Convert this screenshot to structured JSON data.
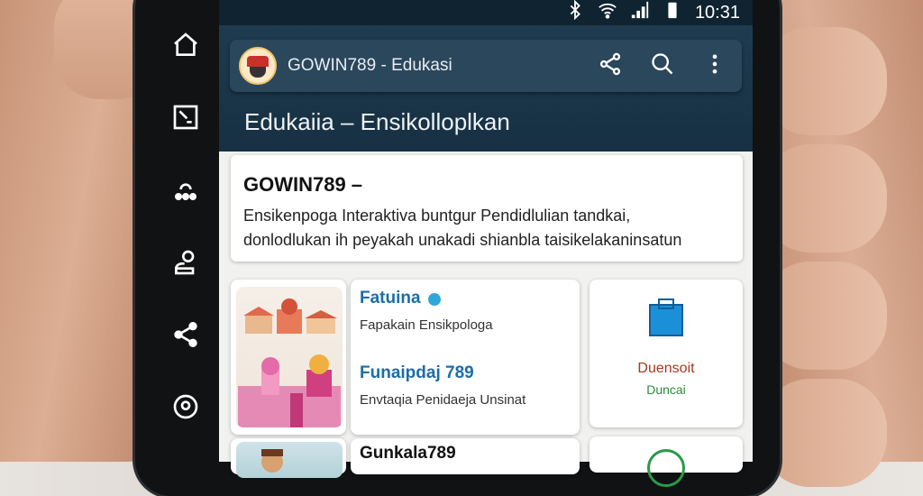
{
  "statusbar": {
    "time": "10:31"
  },
  "toolbar": {
    "title": "GOWIN789 - Edukasi",
    "icons": [
      "share-icon",
      "search-icon",
      "more-vert-icon"
    ]
  },
  "header": {
    "section_title": "Edukaiia – Ensikolloplkan"
  },
  "intro": {
    "title": "GOWIN789 –",
    "line1": "Ensikenpoga Interaktiva buntgur Pendidlulian tandkai,",
    "line2": "donlodlukan ih peyakah unakadi shianbla taisikelakaninsatun"
  },
  "cards": [
    {
      "title": "Fatuina",
      "subtitle": "Fapakain Ensikpologa"
    },
    {
      "title": "Funaipdaj 789",
      "subtitle": "Envtaqia Penidaeja Unsinat"
    },
    {
      "title": "Duensoit",
      "subtitle": "Duncai"
    },
    {
      "title": "Gunkala789"
    }
  ],
  "nav": [
    "home-icon",
    "window-icon",
    "person-icon",
    "account-icon",
    "share-icon",
    "location-icon"
  ]
}
